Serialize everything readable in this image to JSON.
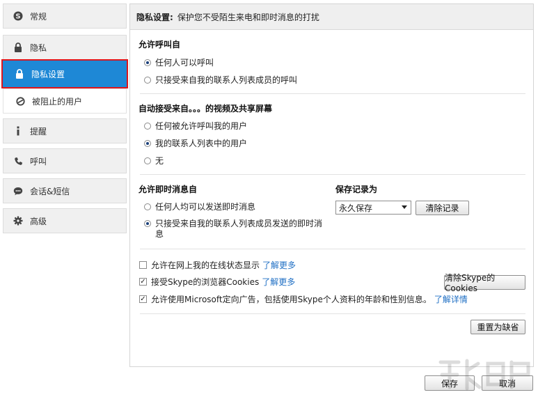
{
  "sidebar": {
    "items": [
      {
        "label": "常规",
        "icon": "skype-icon"
      },
      {
        "label": "隐私",
        "icon": "lock-icon"
      },
      {
        "label": "隐私设置",
        "icon": "lock-icon"
      },
      {
        "label": "被阻止的用户",
        "icon": "blocked-icon"
      },
      {
        "label": "提醒",
        "icon": "info-icon"
      },
      {
        "label": "呼叫",
        "icon": "phone-icon"
      },
      {
        "label": "会话&短信",
        "icon": "chat-icon"
      },
      {
        "label": "高级",
        "icon": "gear-icon"
      }
    ],
    "active_color": "#1e88d6",
    "highlight_color": "#e0161c"
  },
  "header": {
    "title": "隐私设置:",
    "description": "保护您不受陌生来电和即时消息的打扰"
  },
  "calls": {
    "title": "允许呼叫自",
    "options": [
      "任何人可以呼叫",
      "只接受来自我的联系人列表成员的呼叫"
    ],
    "selected": 0
  },
  "video": {
    "title": "自动接受来自。。。的视频及共享屏幕",
    "options": [
      "任何被允许呼叫我的用户",
      "我的联系人列表中的用户",
      "无"
    ],
    "selected": 1
  },
  "im": {
    "title": "允许即时消息自",
    "options": [
      "任何人均可以发送即时消息",
      "只接受来自我的联系人列表成员发送的即时消",
      "息"
    ],
    "selected": 1
  },
  "history": {
    "title": "保存记录为",
    "select_value": "永久保存",
    "clear_button": "清除记录"
  },
  "checks": {
    "online_status": {
      "label": "允许在网上我的在线状态显示",
      "link": "了解更多",
      "checked": false
    },
    "cookies": {
      "label": "接受Skype的浏览器Cookies",
      "link": "了解更多",
      "checked": true
    },
    "ads": {
      "label": "允许使用Microsoft定向广告，包括使用Skype个人资料的年龄和性别信息。",
      "link": "了解详情",
      "checked": true
    }
  },
  "buttons": {
    "clear_cookies": "清除Skype的Cookies",
    "reset": "重置为缺省",
    "save": "保存",
    "cancel": "取消"
  }
}
